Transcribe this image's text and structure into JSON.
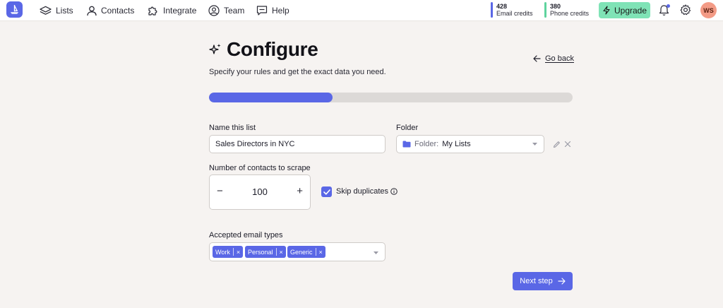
{
  "nav": {
    "items": [
      {
        "label": "Lists",
        "icon": "layers-icon"
      },
      {
        "label": "Contacts",
        "icon": "user-icon"
      },
      {
        "label": "Integrate",
        "icon": "puzzle-icon"
      },
      {
        "label": "Team",
        "icon": "user-circle-icon"
      },
      {
        "label": "Help",
        "icon": "chat-icon"
      }
    ],
    "email_credits": {
      "count": "428",
      "label": "Email credits",
      "color": "#5a67e6"
    },
    "phone_credits": {
      "count": "380",
      "label": "Phone credits",
      "color": "#5fd39e"
    },
    "upgrade_label": "Upgrade",
    "avatar_initials": "WS"
  },
  "page": {
    "title": "Configure",
    "subtitle": "Specify your rules and get the exact data you need.",
    "go_back": "Go back",
    "progress": 0.34
  },
  "form": {
    "list_name_label": "Name this list",
    "list_name_value": "Sales Directors in NYC",
    "folder_label": "Folder",
    "folder_prefix": "Folder:",
    "folder_value": "My Lists",
    "contacts_label": "Number of contacts to scrape",
    "contacts_value": "100",
    "skip_duplicates_label": "Skip duplicates",
    "skip_duplicates_checked": true,
    "email_types_label": "Accepted email types",
    "email_types": [
      "Work",
      "Personal",
      "Generic"
    ],
    "next_label": "Next step"
  },
  "colors": {
    "accent": "#5a67e6",
    "upgrade": "#7fe3b6",
    "avatar": "#f39b86",
    "background": "#f6f3f1"
  }
}
